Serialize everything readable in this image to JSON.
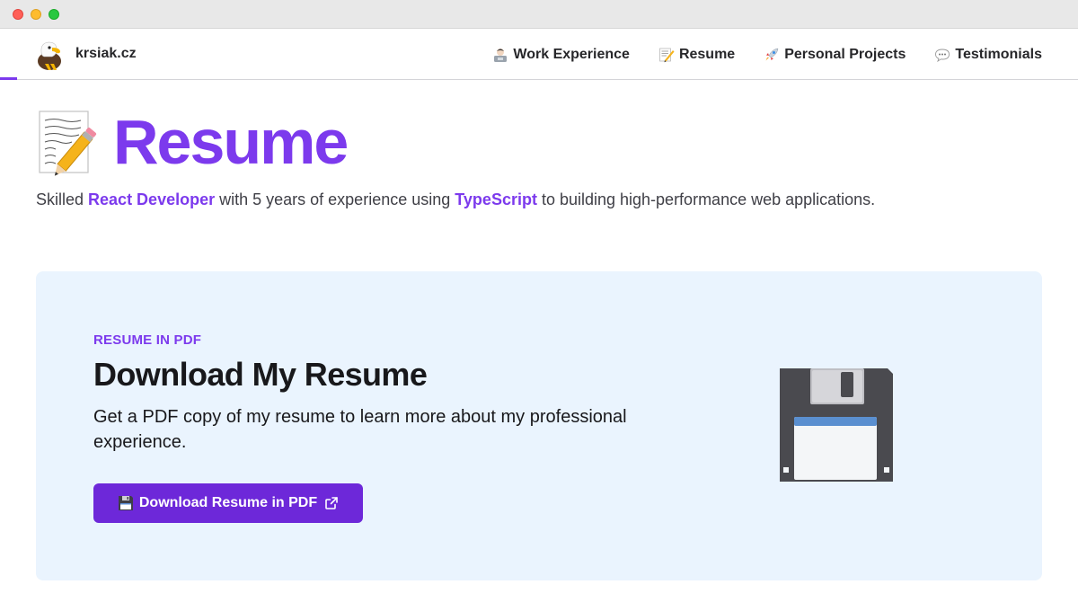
{
  "brand": {
    "name": "krsiak.cz",
    "icon": "eagle-icon"
  },
  "nav": {
    "items": [
      {
        "label": "Work Experience",
        "icon": "technologist-icon"
      },
      {
        "label": "Resume",
        "icon": "memo-icon"
      },
      {
        "label": "Personal Projects",
        "icon": "rocket-icon"
      },
      {
        "label": "Testimonials",
        "icon": "speech-bubble-icon"
      }
    ]
  },
  "hero": {
    "icon": "memo-icon",
    "title": "Resume",
    "subtitle": {
      "before": "Skilled ",
      "highlight1": "React Developer",
      "middle": " with 5 years of experience using ",
      "highlight2": "TypeScript",
      "after": " to building high-performance web applications."
    }
  },
  "download_card": {
    "eyebrow": "RESUME IN PDF",
    "title": "Download My Resume",
    "description": "Get a PDF copy of my resume to learn more about my professional experience.",
    "button_label": "Download Resume in PDF",
    "button_icon": "floppy-disk-icon",
    "external_icon": "external-link-icon",
    "illustration": "floppy-disk-icon"
  },
  "colors": {
    "accent": "#7c3aed",
    "button": "#6d28d9",
    "card_background": "#eaf4fe"
  }
}
